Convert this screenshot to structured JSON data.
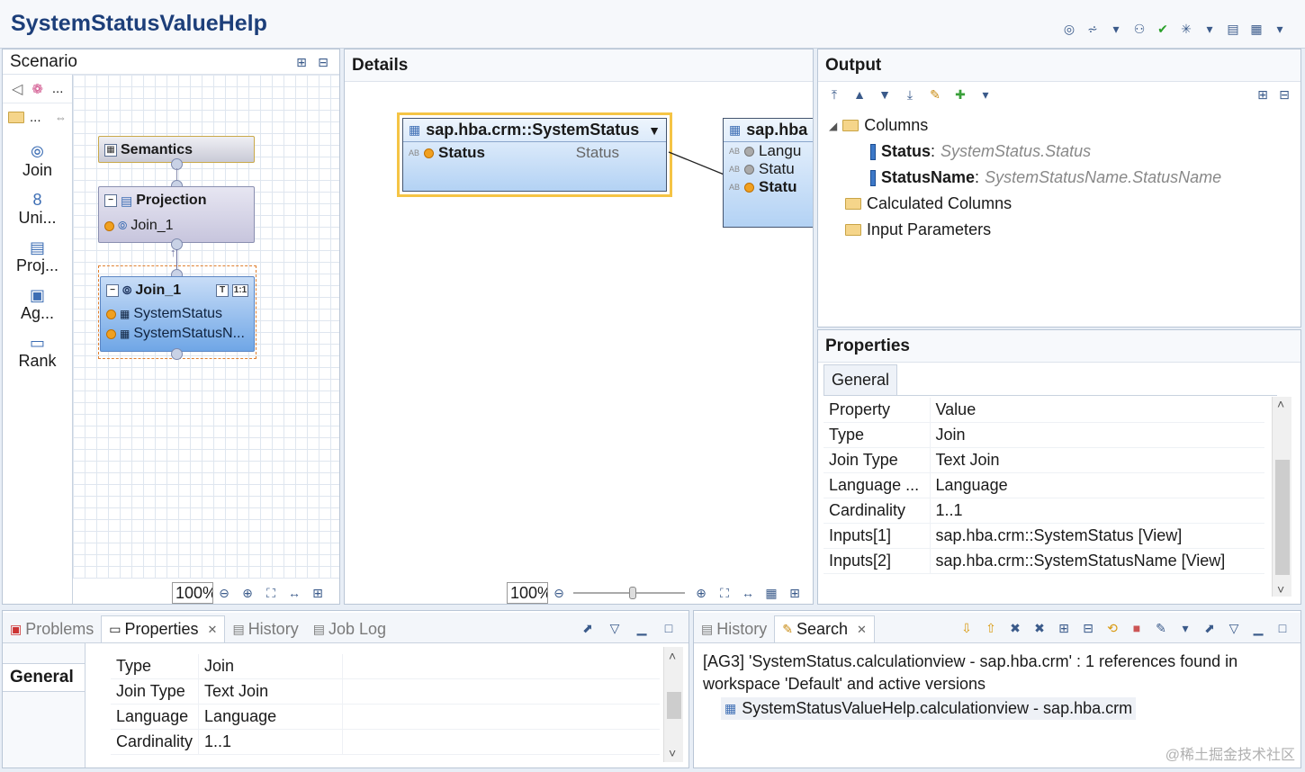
{
  "window": {
    "title": "SystemStatusValueHelp"
  },
  "scenario": {
    "title": "Scenario",
    "palette": [
      {
        "icon": "join-icon",
        "label": "Join"
      },
      {
        "icon": "union-icon",
        "label": "Uni..."
      },
      {
        "icon": "projection-icon",
        "label": "Proj..."
      },
      {
        "icon": "aggregation-icon",
        "label": "Ag..."
      },
      {
        "icon": "rank-icon",
        "label": "Rank"
      }
    ],
    "palette_folder": "...",
    "palette_more": "...",
    "nodes": {
      "semantics": "Semantics",
      "projection": {
        "title": "Projection",
        "input": "Join_1"
      },
      "join": {
        "title": "Join_1",
        "inputs": [
          "SystemStatus",
          "SystemStatusN..."
        ]
      }
    },
    "zoom": "100%"
  },
  "details": {
    "title": "Details",
    "table1": {
      "name": "sap.hba.crm::SystemStatus",
      "column": "Status",
      "alias": "Status"
    },
    "table2": {
      "name": "sap.hba",
      "columns": [
        "Langu",
        "Statu",
        "Statu"
      ]
    },
    "zoom": "100%"
  },
  "output": {
    "title": "Output",
    "columns_label": "Columns",
    "columns": [
      {
        "name": "Status",
        "source": "SystemStatus.Status"
      },
      {
        "name": "StatusName",
        "source": "SystemStatusName.StatusName"
      }
    ],
    "calculated": "Calculated Columns",
    "params": "Input Parameters"
  },
  "properties": {
    "title": "Properties",
    "tab": "General",
    "header": {
      "property": "Property",
      "value": "Value"
    },
    "rows": [
      {
        "p": "Type",
        "v": "Join"
      },
      {
        "p": "Join Type",
        "v": "Text Join"
      },
      {
        "p": "Language ...",
        "v": "Language"
      },
      {
        "p": "Cardinality",
        "v": "1..1"
      },
      {
        "p": "Inputs[1]",
        "v": "sap.hba.crm::SystemStatus [View]"
      },
      {
        "p": "Inputs[2]",
        "v": "sap.hba.crm::SystemStatusName [View]"
      }
    ]
  },
  "bottom_left": {
    "tabs": [
      {
        "label": "Problems",
        "active": false
      },
      {
        "label": "Properties",
        "active": true
      },
      {
        "label": "History",
        "active": false
      },
      {
        "label": "Job Log",
        "active": false
      }
    ],
    "section": "General",
    "rows": [
      {
        "p": "Type",
        "v": "Join"
      },
      {
        "p": "Join Type",
        "v": "Text Join"
      },
      {
        "p": "Language",
        "v": "Language"
      },
      {
        "p": "Cardinality",
        "v": "1..1"
      }
    ]
  },
  "bottom_right": {
    "tabs": [
      {
        "label": "History",
        "active": false
      },
      {
        "label": "Search",
        "active": true
      }
    ],
    "message": "[AG3] 'SystemStatus.calculationview - sap.hba.crm' : 1 references found in workspace 'Default' and active versions",
    "result": "SystemStatusValueHelp.calculationview - sap.hba.crm"
  },
  "watermark": "@稀土掘金技术社区"
}
